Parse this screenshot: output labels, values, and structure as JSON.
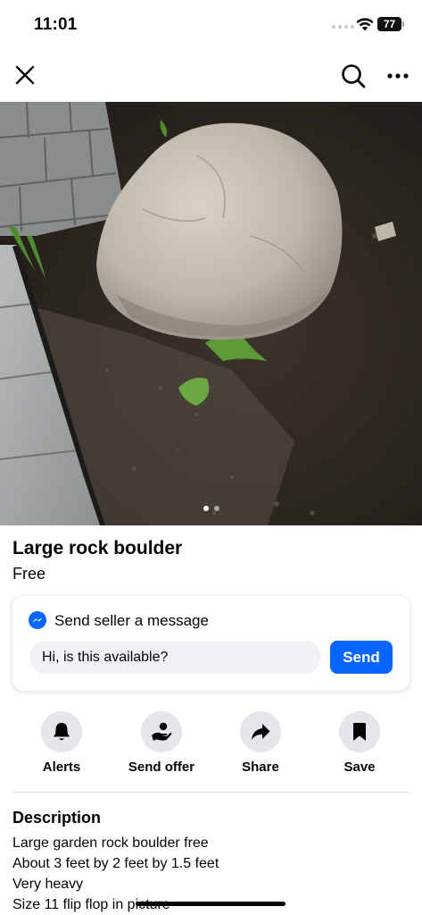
{
  "status_bar": {
    "time": "11:01",
    "battery_percent": 77,
    "battery_label": "77"
  },
  "nav": {
    "close_icon": "close-icon",
    "search_icon": "search-icon",
    "more_icon": "more-horizontal-icon"
  },
  "photo": {
    "description_icon": "listing-photo",
    "page_count": 2,
    "current_page": 1
  },
  "listing": {
    "title": "Large rock boulder",
    "price": "Free"
  },
  "message_card": {
    "heading": "Send seller a message",
    "input_value": "Hi, is this available?",
    "send_label": "Send",
    "accent_color": "#0866ff"
  },
  "actions": [
    {
      "label": "Alerts",
      "icon": "bell-icon"
    },
    {
      "label": "Send offer",
      "icon": "offer-icon"
    },
    {
      "label": "Share",
      "icon": "share-arrow-icon"
    },
    {
      "label": "Save",
      "icon": "bookmark-icon"
    }
  ],
  "description": {
    "heading": "Description",
    "lines": [
      "Large garden rock boulder free",
      "About 3 feet by 2 feet by 1.5 feet",
      "Very heavy",
      "Size 11 flip flop in picture"
    ]
  }
}
